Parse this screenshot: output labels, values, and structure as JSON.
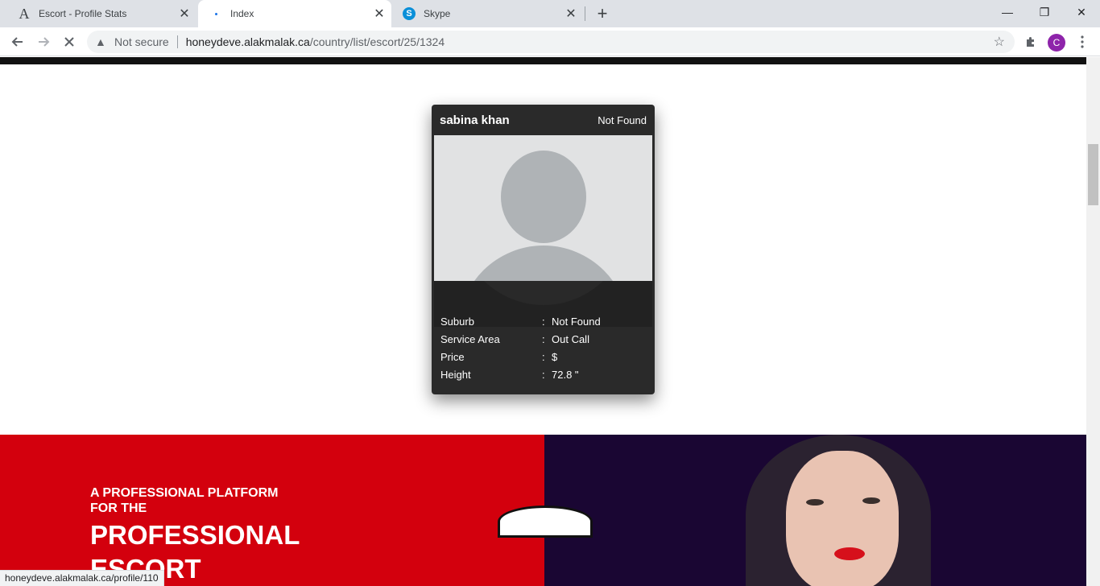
{
  "browser": {
    "tabs": [
      {
        "title": "Escort - Profile Stats",
        "icon": "letter-a-icon"
      },
      {
        "title": "Index",
        "icon": "loading-dot-icon"
      },
      {
        "title": "Skype",
        "icon": "skype-icon"
      }
    ],
    "window_controls": {
      "minimize": "—",
      "restore": "❐",
      "close": "✕"
    },
    "security_label": "Not secure",
    "url_host": "honeydeve.alakmalak.ca",
    "url_path": "/country/list/escort/25/1324",
    "profile_initial": "C",
    "profile_color": "#8e24aa"
  },
  "profile_card": {
    "name": "sabina khan",
    "status": "Not Found",
    "details": [
      {
        "label": "Suburb",
        "separator": ":",
        "value": "Not Found"
      },
      {
        "label": "Service Area",
        "separator": ":",
        "value": "Out Call"
      },
      {
        "label": "Price",
        "separator": ":",
        "value": "$"
      },
      {
        "label": "Height",
        "separator": ":",
        "value": "72.8 \""
      }
    ]
  },
  "hero": {
    "subtitle_line1": "A PROFESSIONAL PLATFORM",
    "subtitle_line2": "FOR THE",
    "headline_line1": "PROFESSIONAL",
    "headline_line2": "ESCORT",
    "accent_color": "#d3000d"
  },
  "status_bar": {
    "link": "honeydeve.alakmalak.ca/profile/110"
  }
}
